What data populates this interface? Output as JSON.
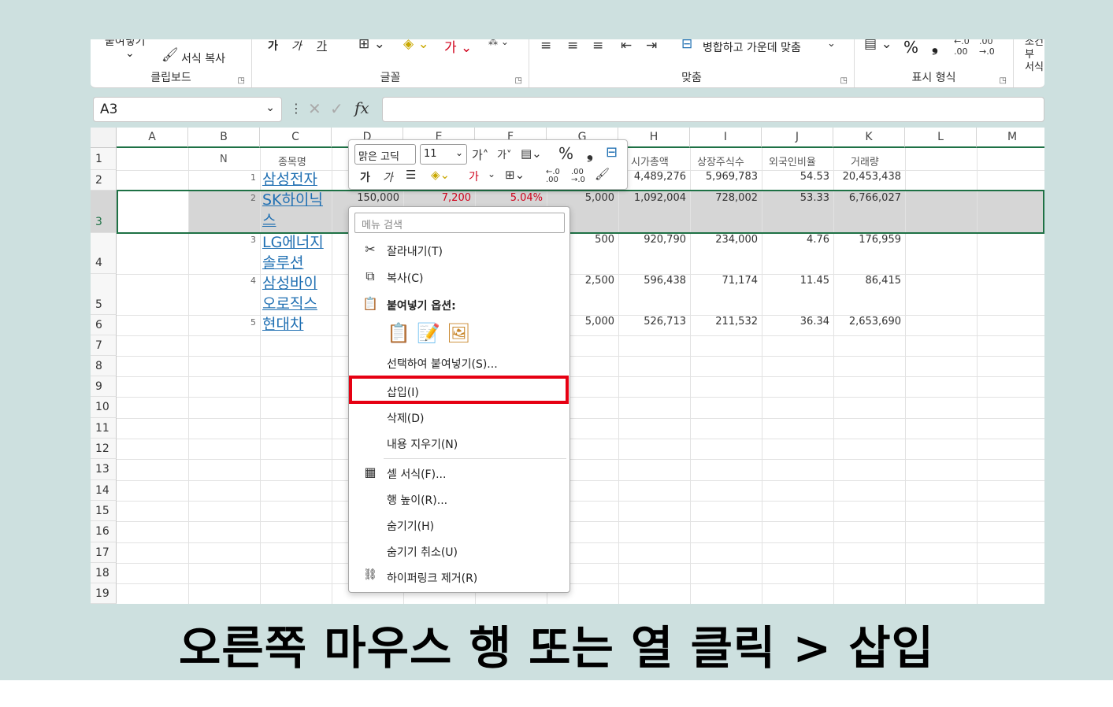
{
  "ribbon": {
    "clipboard": {
      "paste_label": "붙여넣기",
      "paste_arrow": "⌄",
      "format_painter_label": "서식 복사",
      "group": "클립보드"
    },
    "font": {
      "bold": "가",
      "italic": "가",
      "underline": "가",
      "group": "글꼴"
    },
    "alignment": {
      "merge_label": "병합하고 가운데 맞춤",
      "group": "맞춤"
    },
    "number": {
      "percent": "%",
      "comma": "❟",
      "group": "표시 형식"
    },
    "styles": {
      "label": "조건부 서식"
    }
  },
  "formula_bar": {
    "name_box": "A3",
    "fx": "fx",
    "formula": ""
  },
  "columns": [
    "A",
    "B",
    "C",
    "D",
    "E",
    "F",
    "G",
    "H",
    "I",
    "J",
    "K",
    "L",
    "M"
  ],
  "rows": [
    "1",
    "2",
    "3",
    "4",
    "5",
    "6",
    "7",
    "8",
    "9",
    "10",
    "11",
    "12",
    "13",
    "14",
    "15",
    "16",
    "17",
    "18",
    "19"
  ],
  "headers": {
    "n": "N",
    "name": "종목명",
    "market_cap": "시가총액",
    "shares": "상장주식수",
    "foreign": "외국인비율",
    "volume": "거래량"
  },
  "stocks": [
    {
      "idx": "1",
      "name": "삼성전자",
      "market_cap": "4,489,276",
      "shares": "5,969,783",
      "foreign": "54.53",
      "volume": "20,453,438"
    },
    {
      "idx": "2",
      "name": "SK하이닉스",
      "price": "150,000",
      "change": "7,200",
      "rate": "5.04%",
      "par": "5,000",
      "market_cap": "1,092,004",
      "shares": "728,002",
      "foreign": "53.33",
      "volume": "6,766,027"
    },
    {
      "idx": "3",
      "name": "LG에너지솔루션",
      "par": "500",
      "market_cap": "920,790",
      "shares": "234,000",
      "foreign": "4.76",
      "volume": "176,959"
    },
    {
      "idx": "4",
      "name": "삼성바이오로직스",
      "par": "2,500",
      "market_cap": "596,438",
      "shares": "71,174",
      "foreign": "11.45",
      "volume": "86,415"
    },
    {
      "idx": "5",
      "name": "현대차",
      "par": "5,000",
      "market_cap": "526,713",
      "shares": "211,532",
      "foreign": "36.34",
      "volume": "2,653,690"
    }
  ],
  "mini_toolbar": {
    "font": "맑은 고딕",
    "size": "11",
    "grow": "가˄",
    "shrink": "가˅",
    "percent": "%",
    "comma": "❟",
    "bold": "가",
    "italic": "가",
    "font_color": "가"
  },
  "context_menu": {
    "search_placeholder": "메뉴 검색",
    "cut": "잘라내기(T)",
    "copy": "복사(C)",
    "paste_options": "붙여넣기 옵션:",
    "paste_special": "선택하여 붙여넣기(S)...",
    "insert": "삽입(I)",
    "delete": "삭제(D)",
    "clear": "내용 지우기(N)",
    "format_cells": "셀 서식(F)...",
    "row_height": "행 높이(R)...",
    "hide": "숨기기(H)",
    "unhide": "숨기기 취소(U)",
    "remove_hyperlinks": "하이퍼링크 제거(R)"
  },
  "caption": "오른쪽 마우스 행 또는 열 클릭 > 삽입",
  "colors": {
    "accent": "#1e7145",
    "highlight": "#e60012",
    "link": "#1f6fb2",
    "background": "#cde0df"
  }
}
